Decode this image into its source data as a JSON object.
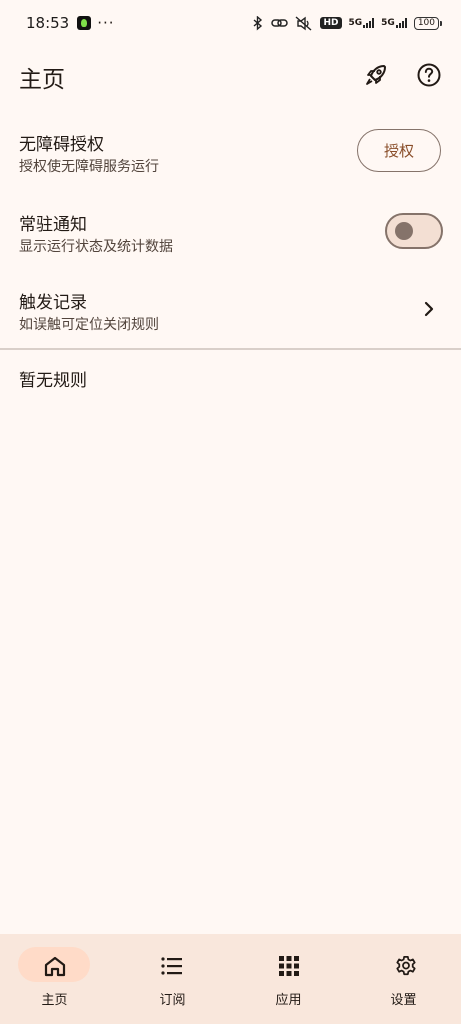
{
  "status_bar": {
    "time": "18:53",
    "dots": "···",
    "hd_label": "HD",
    "sig1_label": "5G",
    "sig2_label": "5G",
    "battery": "100"
  },
  "header": {
    "title": "主页"
  },
  "rows": [
    {
      "title": "无障碍授权",
      "subtitle": "授权使无障碍服务运行",
      "action_label": "授权"
    },
    {
      "title": "常驻通知",
      "subtitle": "显示运行状态及统计数据",
      "toggle_on": false
    },
    {
      "title": "触发记录",
      "subtitle": "如误触可定位关闭规则"
    }
  ],
  "empty_message": "暂无规则",
  "nav": {
    "items": [
      {
        "label": "主页",
        "icon": "home-icon",
        "active": true
      },
      {
        "label": "订阅",
        "icon": "list-icon",
        "active": false
      },
      {
        "label": "应用",
        "icon": "apps-grid-icon",
        "active": false
      },
      {
        "label": "设置",
        "icon": "gear-icon",
        "active": false
      }
    ]
  },
  "colors": {
    "background": "#fff8f4",
    "nav_background": "#f9e7dc",
    "nav_active_pill": "#ffdbc8",
    "accent_text": "#8a4e2a",
    "outline": "#85736a"
  }
}
